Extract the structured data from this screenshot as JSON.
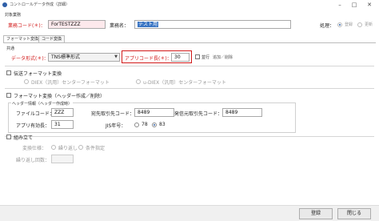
{
  "window": {
    "title": "コントロールデータ作成（詳細）",
    "minimize": "–",
    "maximize": "□",
    "close": "✕"
  },
  "header": {
    "section_label": "対象業務",
    "business_code_label": "業務コード(＊)：",
    "business_code_value": "ForTESTZZZ",
    "business_name_label": "業務名：",
    "business_name_value": "テスト用",
    "processing_label": "処理：",
    "processing_options": [
      "登録",
      "更新"
    ],
    "processing_selected": "登録"
  },
  "tabs": [
    "フォーマット変換",
    "コード変換"
  ],
  "common": {
    "section_label": "共通",
    "data_format_label": "データ形式(＊)：",
    "data_format_value": "TNS標準形式",
    "appl_code_label": "アプリコード長(＊)：",
    "appl_code_value": "30",
    "parallel_label": "並行",
    "parallel_note": "追加／削除"
  },
  "transfer": {
    "title": "伝送フォーマット変換",
    "options": [
      "DIEX（汎用）センターフォーマット",
      "u-DIEX（汎用）センターフォーマット"
    ]
  },
  "format": {
    "title": "フォーマット変換（ヘッダー作成／削除）",
    "header_info_label": "ヘッダー情報（ヘッダー作成時）",
    "file_code_label": "ファイルコード：",
    "file_code_value": "ZZZ",
    "dest_code_label": "宛先取引先コード：",
    "dest_code_value": "8489",
    "src_code_label": "発信元取引先コード：",
    "src_code_value": "8489",
    "appl_valid_label": "アプリ有効長：",
    "appl_valid_value": "31",
    "jis_label": "JIS年号：",
    "jis_options": [
      "78",
      "83"
    ],
    "jis_selected": "83"
  },
  "assemble": {
    "title": "組み立て",
    "spec_label": "変換仕様：",
    "spec_options": [
      "繰り返し",
      "条件指定"
    ],
    "repeat_label": "繰り返し回数："
  },
  "footer": {
    "register_label": "登録",
    "close_label": "閉じる"
  }
}
